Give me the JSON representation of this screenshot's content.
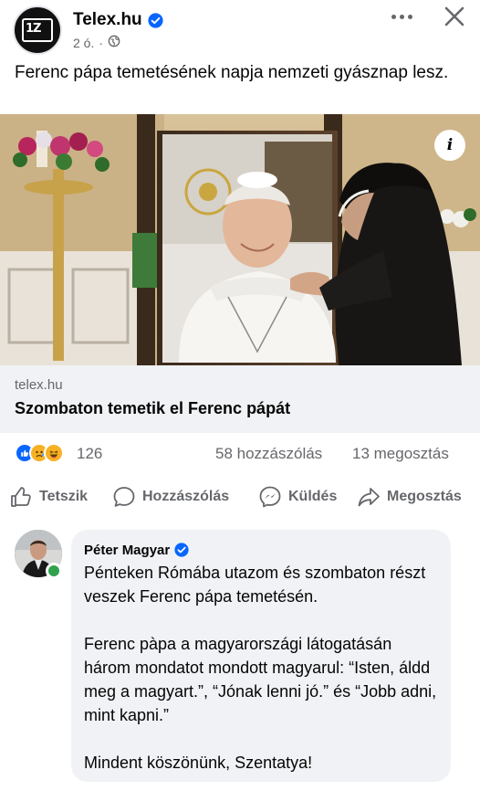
{
  "header": {
    "page_name": "Telex.hu",
    "time": "2 ó.",
    "separator": "·",
    "avatar_text": "1Z"
  },
  "post": {
    "text": "Ferenc pápa temetésének napja nemzeti gyásznap lesz.",
    "info_label": "i"
  },
  "link": {
    "domain": "telex.hu",
    "title": "Szombaton temetik el Ferenc pápát"
  },
  "stats": {
    "reactions_count": "126",
    "comments": "58 hozzászólás",
    "shares": "13 megosztás",
    "reaction_icons": [
      "like-icon",
      "sad-icon",
      "haha-icon"
    ]
  },
  "actions": {
    "like": "Tetszik",
    "comment": "Hozzászólás",
    "send": "Küldés",
    "share": "Megosztás"
  },
  "comment": {
    "author": "Péter Magyar",
    "para1": "Pénteken Rómába utazom és szombaton részt veszek Ferenc pápa temetésén.",
    "para2": "Ferenc pàpa a magyarországi látogatásán három mondatot mondott magyarul: “Isten, áldd meg a magyart.”, “Jónak lenni jó.” és “Jobb adni, mint kapni.”",
    "para3": "Mindent köszönünk, Szentatya!"
  },
  "colors": {
    "accent": "#0866ff",
    "secondary_text": "#65676b",
    "bubble": "#f0f2f5",
    "online": "#31a24c"
  }
}
